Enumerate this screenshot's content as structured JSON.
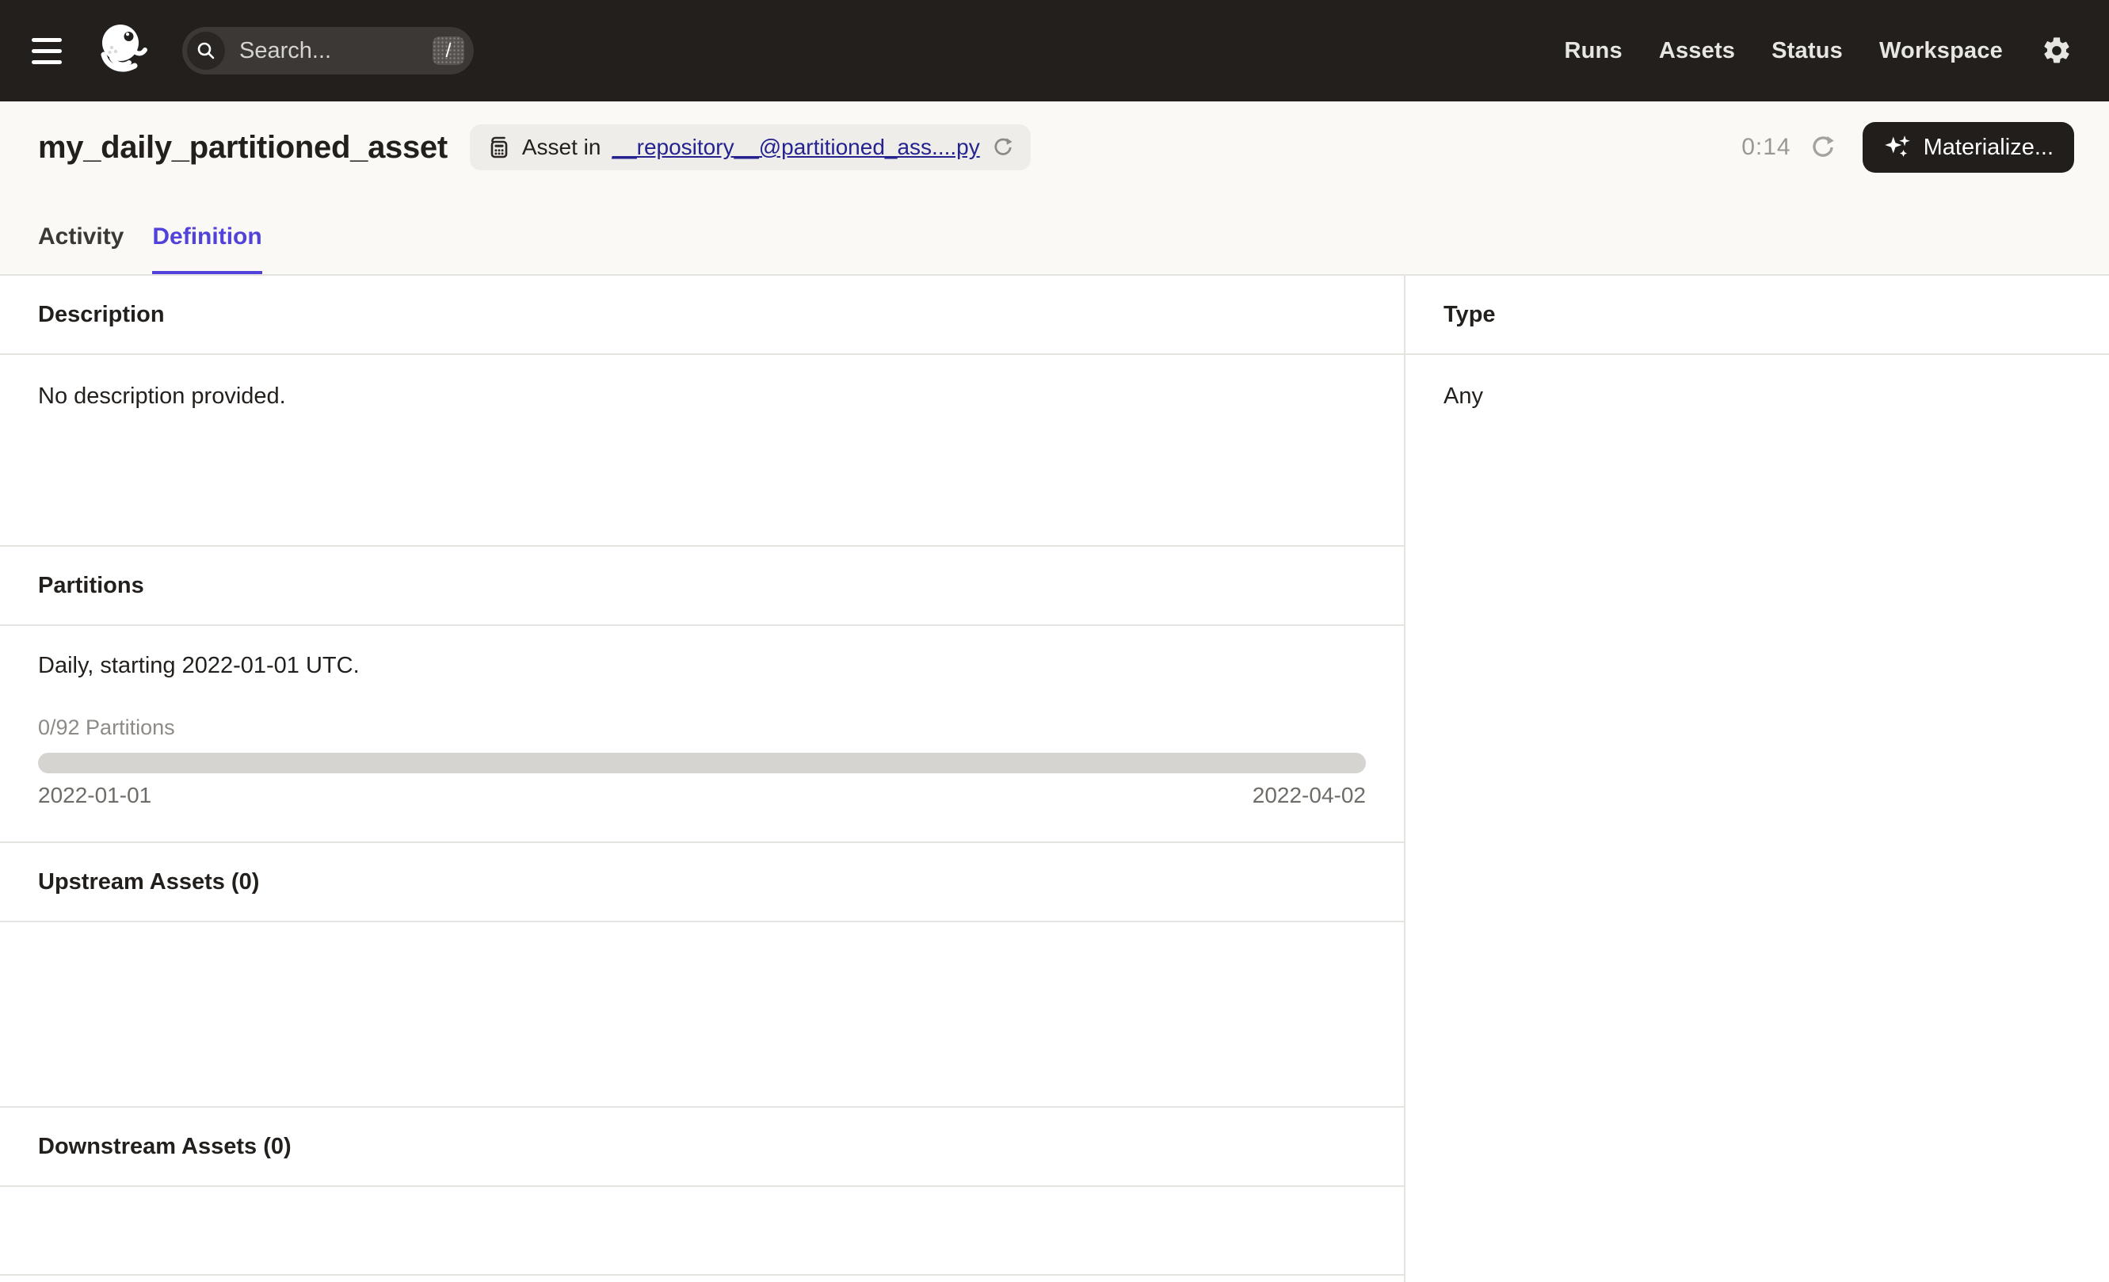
{
  "navbar": {
    "search": {
      "placeholder": "Search...",
      "shortcut_key": "/"
    },
    "links": [
      "Runs",
      "Assets",
      "Status",
      "Workspace"
    ]
  },
  "header": {
    "title": "my_daily_partitioned_asset",
    "asset_badge": {
      "prefix": "Asset in",
      "repository_link": "__repository__@partitioned_ass....py"
    },
    "auto_refresh": {
      "countdown": "0:14"
    },
    "materialize_button": {
      "label": "Materialize..."
    }
  },
  "tabs": [
    {
      "label": "Activity",
      "active": false
    },
    {
      "label": "Definition",
      "active": true
    }
  ],
  "main": {
    "description": {
      "heading": "Description",
      "body": "No description provided."
    },
    "partitions": {
      "heading": "Partitions",
      "schedule": "Daily, starting 2022-01-01 UTC.",
      "progress_label": "0/92 Partitions",
      "progress_percent": 0,
      "range_start": "2022-01-01",
      "range_end": "2022-04-02"
    },
    "upstream": {
      "heading": "Upstream Assets (0)"
    },
    "downstream": {
      "heading": "Downstream Assets (0)"
    },
    "type": {
      "heading": "Type",
      "value": "Any"
    }
  },
  "icons": {
    "menu": "hamburger",
    "search": "magnifier",
    "shortcut": "slash-key",
    "settings": "gear",
    "asset_badge": "grid-table-copy",
    "reload": "circular-arrow",
    "auto_refresh": "circular-arrow",
    "materialize": "sparkles"
  },
  "colors": {
    "navbar_bg": "#231F1C",
    "header_band_bg": "#FAF9F6",
    "keyline": "#E6E4E1",
    "tab_accent": "#5143D9",
    "link": "#24238F",
    "progress_track": "#D6D4D1",
    "muted_label": "#8E8B87",
    "range_text": "#6F6C68",
    "countdown_text": "#9B9894"
  }
}
